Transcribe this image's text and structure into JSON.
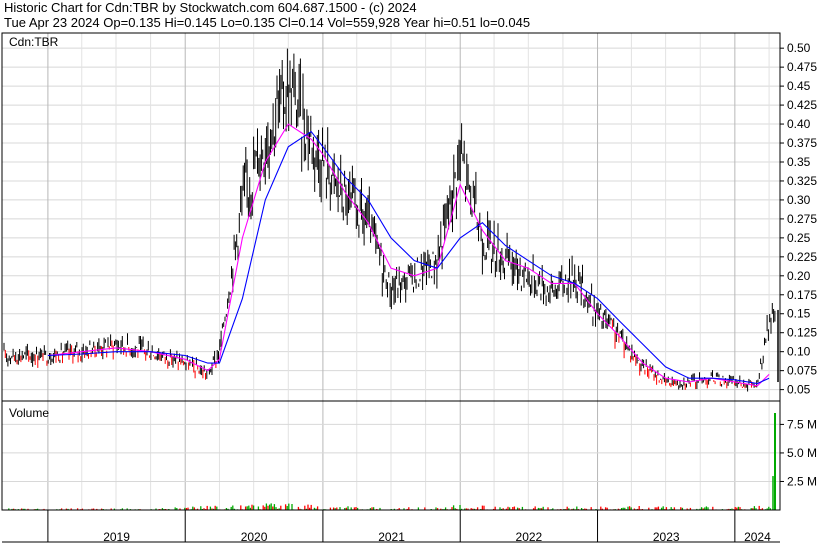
{
  "header": {
    "line1": "Historic Chart for Cdn:TBR by Stockwatch.com 604.687.1500 - (c) 2024",
    "line2": "Tue Apr 23 2024  Op=0.135  Hi=0.145  Lo=0.135  Cl=0.14  Vol=559,928  Year hi=0.51  lo=0.045"
  },
  "chart_data": [
    {
      "type": "line",
      "title": "Cdn:TBR",
      "x": [
        "2019-01",
        "2019-04",
        "2019-07",
        "2019-10",
        "2020-01",
        "2020-03",
        "2020-04",
        "2020-06",
        "2020-08",
        "2020-10",
        "2020-12",
        "2021-01",
        "2021-03",
        "2021-05",
        "2021-07",
        "2021-09",
        "2021-11",
        "2022-01",
        "2022-03",
        "2022-05",
        "2022-07",
        "2022-09",
        "2022-11",
        "2023-01",
        "2023-03",
        "2023-05",
        "2023-07",
        "2023-09",
        "2023-11",
        "2024-01",
        "2024-03",
        "2024-04"
      ],
      "series": [
        {
          "values": [
            0.095,
            0.1,
            0.11,
            0.1,
            0.085,
            0.07,
            0.1,
            0.3,
            0.38,
            0.45,
            0.38,
            0.35,
            0.3,
            0.27,
            0.18,
            0.2,
            0.22,
            0.36,
            0.25,
            0.22,
            0.2,
            0.18,
            0.2,
            0.15,
            0.12,
            0.08,
            0.06,
            0.06,
            0.065,
            0.06,
            0.055,
            0.14
          ]
        },
        {
          "values": [
            0.095,
            0.1,
            0.105,
            0.1,
            0.09,
            0.075,
            0.09,
            0.25,
            0.35,
            0.4,
            0.38,
            0.36,
            0.31,
            0.27,
            0.21,
            0.2,
            0.21,
            0.32,
            0.26,
            0.22,
            0.21,
            0.19,
            0.19,
            0.15,
            0.12,
            0.085,
            0.065,
            0.06,
            0.065,
            0.06,
            0.055,
            0.07
          ]
        },
        {
          "values": [
            0.095,
            0.097,
            0.1,
            0.1,
            0.095,
            0.085,
            0.085,
            0.17,
            0.3,
            0.37,
            0.39,
            0.37,
            0.33,
            0.3,
            0.25,
            0.22,
            0.21,
            0.25,
            0.27,
            0.24,
            0.22,
            0.2,
            0.19,
            0.17,
            0.14,
            0.11,
            0.08,
            0.065,
            0.065,
            0.063,
            0.058,
            0.065
          ]
        }
      ],
      "yticks": [
        "0.05",
        "0.075",
        "0.10",
        "0.125",
        "0.15",
        "0.175",
        "0.20",
        "0.225",
        "0.25",
        "0.275",
        "0.30",
        "0.325",
        "0.35",
        "0.375",
        "0.40",
        "0.425",
        "0.45",
        "0.475",
        "0.50"
      ],
      "ylim": [
        0.035,
        0.52
      ],
      "grid": true,
      "colors": {
        "price": "#000000",
        "short_ma": "#ff00ff",
        "long_ma": "#0000ff",
        "down_bar": "#ff0000"
      }
    },
    {
      "type": "bar",
      "title": "Volume",
      "x": [
        "2019-02",
        "2019-06",
        "2019-10",
        "2020-02",
        "2020-06",
        "2020-10",
        "2021-01",
        "2021-05",
        "2021-09",
        "2022-01",
        "2022-05",
        "2022-09",
        "2023-01",
        "2023-05",
        "2023-09",
        "2024-01",
        "2024-04"
      ],
      "values": [
        0.12,
        0.15,
        0.1,
        0.3,
        0.4,
        0.55,
        0.3,
        0.25,
        0.2,
        0.55,
        0.25,
        0.3,
        0.25,
        0.3,
        0.25,
        0.3,
        8.5
      ],
      "yticks": [
        "2.5 M",
        "5.0 M",
        "7.5 M"
      ],
      "ylim": [
        0,
        9.2
      ],
      "colors": {
        "up": "#00aa00",
        "down": "#ff0000"
      }
    }
  ],
  "x_axis": {
    "labels": [
      "2019",
      "2020",
      "2021",
      "2022",
      "2023",
      "2024"
    ]
  }
}
